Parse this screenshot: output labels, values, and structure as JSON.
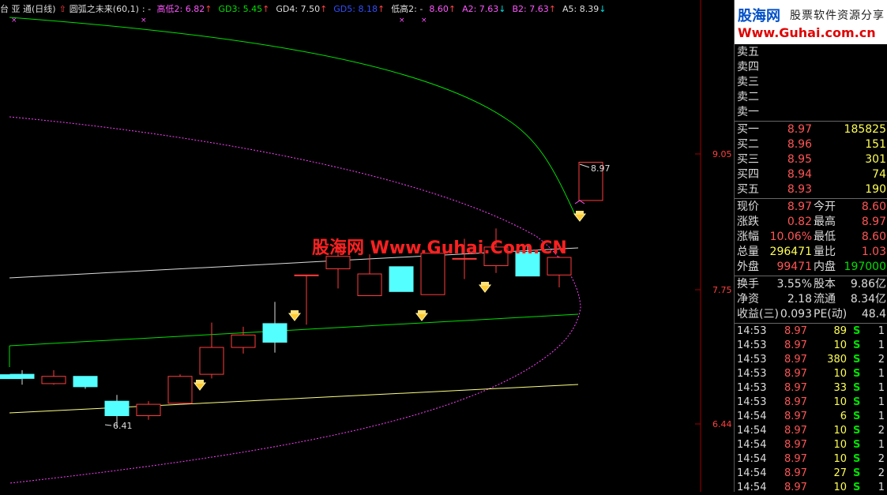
{
  "header": {
    "stock": "台 亚 通(日线)",
    "indicator": "圆弧之未来(60,1)",
    "sep": ": -",
    "items": [
      {
        "label": "高低2: 6.82",
        "color": "#ff55ff",
        "arrow": "↑",
        "arrow_color": "#ff4040"
      },
      {
        "label": "GD3: 5.45",
        "color": "#00e000",
        "arrow": "↑",
        "arrow_color": "#ff4040"
      },
      {
        "label": "GD4: 7.50",
        "color": "#dddddd",
        "arrow": "↑",
        "arrow_color": "#ff4040"
      },
      {
        "label": "GD5: 8.18",
        "color": "#3050ff",
        "arrow": "↑",
        "arrow_color": "#ff4040"
      },
      {
        "label": "低高2: -",
        "color": "#dddddd",
        "arrow": "",
        "arrow_color": "#ff4040"
      },
      {
        "label": "8.60",
        "color": "#ff55ff",
        "arrow": "↑",
        "arrow_color": "#ff4040"
      },
      {
        "label": "A2: 7.63",
        "color": "#ff55ff",
        "arrow": "↓",
        "arrow_color": "#00e0e0"
      },
      {
        "label": "B2: 7.63",
        "color": "#ff55ff",
        "arrow": "↑",
        "arrow_color": "#ff4040"
      },
      {
        "label": "A5: 8.39",
        "color": "#dddddd",
        "arrow": "↓",
        "arrow_color": "#00e0e0"
      }
    ]
  },
  "axis": {
    "labels": [
      "9.05",
      "7.75",
      "6.44"
    ],
    "high_label": "8.97",
    "low_label": "6.41"
  },
  "watermark": "股海网 Www.Guhai.Com.CN",
  "logo": {
    "line1": "股海网",
    "line1b": "股票软件资源分享",
    "line2": "Www.Guhai.com.cn"
  },
  "quote": {
    "sell": [
      {
        "label": "卖五",
        "price": "",
        "vol": ""
      },
      {
        "label": "卖四",
        "price": "",
        "vol": ""
      },
      {
        "label": "卖三",
        "price": "",
        "vol": ""
      },
      {
        "label": "卖二",
        "price": "",
        "vol": ""
      },
      {
        "label": "卖一",
        "price": "",
        "vol": ""
      }
    ],
    "buy": [
      {
        "label": "买一",
        "price": "8.97",
        "vol": "185825"
      },
      {
        "label": "买二",
        "price": "8.96",
        "vol": "151"
      },
      {
        "label": "买三",
        "price": "8.95",
        "vol": "301"
      },
      {
        "label": "买四",
        "price": "8.94",
        "vol": "74"
      },
      {
        "label": "买五",
        "price": "8.93",
        "vol": "190"
      }
    ],
    "stats": [
      {
        "l1": "现价",
        "v1": "8.97",
        "c1": "#ff5555",
        "l2": "今开",
        "v2": "8.60",
        "c2": "#ff5555"
      },
      {
        "l1": "涨跌",
        "v1": "0.82",
        "c1": "#ff5555",
        "l2": "最高",
        "v2": "8.97",
        "c2": "#ff5555"
      },
      {
        "l1": "涨幅",
        "v1": "10.06%",
        "c1": "#ff5555",
        "l2": "最低",
        "v2": "8.60",
        "c2": "#ff5555"
      },
      {
        "l1": "总量",
        "v1": "296471",
        "c1": "#ffff54",
        "l2": "量比",
        "v2": "1.03",
        "c2": "#ff5555"
      },
      {
        "l1": "外盘",
        "v1": "99471",
        "c1": "#ff5555",
        "l2": "内盘",
        "v2": "197000",
        "c2": "#00e000"
      }
    ],
    "stats2": [
      {
        "l1": "换手",
        "v1": "3.55%",
        "c1": "#ddd",
        "l2": "股本",
        "v2": "9.86亿",
        "c2": "#ddd"
      },
      {
        "l1": "净资",
        "v1": "2.18",
        "c1": "#ddd",
        "l2": "流通",
        "v2": "8.34亿",
        "c2": "#ddd"
      },
      {
        "l1": "收益(三)",
        "v1": "0.093",
        "c1": "#ddd",
        "l2": "PE(动)",
        "v2": "48.4",
        "c2": "#ddd"
      }
    ],
    "ticks": [
      {
        "t": "14:53",
        "p": "8.97",
        "v": "89",
        "s": "S",
        "n": "1"
      },
      {
        "t": "14:53",
        "p": "8.97",
        "v": "10",
        "s": "S",
        "n": "1"
      },
      {
        "t": "14:53",
        "p": "8.97",
        "v": "380",
        "s": "S",
        "n": "2"
      },
      {
        "t": "14:53",
        "p": "8.97",
        "v": "10",
        "s": "S",
        "n": "1"
      },
      {
        "t": "14:53",
        "p": "8.97",
        "v": "33",
        "s": "S",
        "n": "1"
      },
      {
        "t": "14:53",
        "p": "8.97",
        "v": "10",
        "s": "S",
        "n": "1"
      },
      {
        "t": "14:54",
        "p": "8.97",
        "v": "6",
        "s": "S",
        "n": "1"
      },
      {
        "t": "14:54",
        "p": "8.97",
        "v": "10",
        "s": "S",
        "n": "2"
      },
      {
        "t": "14:54",
        "p": "8.97",
        "v": "10",
        "s": "S",
        "n": "1"
      },
      {
        "t": "14:54",
        "p": "8.97",
        "v": "10",
        "s": "S",
        "n": "2"
      },
      {
        "t": "14:54",
        "p": "8.97",
        "v": "27",
        "s": "S",
        "n": "2"
      },
      {
        "t": "14:54",
        "p": "8.97",
        "v": "10",
        "s": "S",
        "n": "1"
      }
    ]
  },
  "colors": {
    "up": "#ff3c3c",
    "down": "#54ffff",
    "curve_top": "#00e000",
    "curve_dotted": "#ff40ff",
    "channel_top": "#dddddd",
    "channel_mid": "#00e000",
    "channel_low": "#ffff80"
  },
  "chart_data": {
    "type": "candlestick",
    "candles": [
      {
        "o": 6.92,
        "c": 6.88,
        "h": 6.96,
        "l": 6.82
      },
      {
        "o": 6.83,
        "c": 6.9,
        "h": 6.96,
        "l": 6.82
      },
      {
        "o": 6.9,
        "c": 6.8,
        "h": 6.9,
        "l": 6.78
      },
      {
        "o": 6.66,
        "c": 6.52,
        "h": 6.72,
        "l": 6.41
      },
      {
        "o": 6.52,
        "c": 6.63,
        "h": 6.66,
        "l": 6.48
      },
      {
        "o": 6.64,
        "c": 6.9,
        "h": 6.92,
        "l": 6.63
      },
      {
        "o": 6.92,
        "c": 7.18,
        "h": 7.42,
        "l": 6.88
      },
      {
        "o": 7.18,
        "c": 7.3,
        "h": 7.38,
        "l": 7.12
      },
      {
        "o": 7.41,
        "c": 7.23,
        "h": 7.62,
        "l": 7.13
      },
      {
        "o": 7.88,
        "c": 7.88,
        "h": 7.88,
        "l": 7.4
      },
      {
        "o": 7.94,
        "c": 8.06,
        "h": 8.16,
        "l": 7.75
      },
      {
        "o": 7.68,
        "c": 7.89,
        "h": 8.08,
        "l": 7.68
      },
      {
        "o": 7.96,
        "c": 7.72,
        "h": 7.96,
        "l": 7.72
      },
      {
        "o": 7.69,
        "c": 8.09,
        "h": 8.11,
        "l": 7.69
      },
      {
        "o": 8.04,
        "c": 8.04,
        "h": 8.23,
        "l": 7.84
      },
      {
        "o": 7.97,
        "c": 8.15,
        "h": 8.33,
        "l": 7.9
      },
      {
        "o": 8.1,
        "c": 7.87,
        "h": 8.18,
        "l": 7.87
      },
      {
        "o": 7.88,
        "c": 8.05,
        "h": 8.06,
        "l": 7.76
      },
      {
        "o": 8.6,
        "c": 8.97,
        "h": 8.97,
        "l": 8.6
      }
    ],
    "axis_ticks": [
      9.05,
      7.75,
      6.44
    ],
    "high": 8.97,
    "low": 6.41
  }
}
